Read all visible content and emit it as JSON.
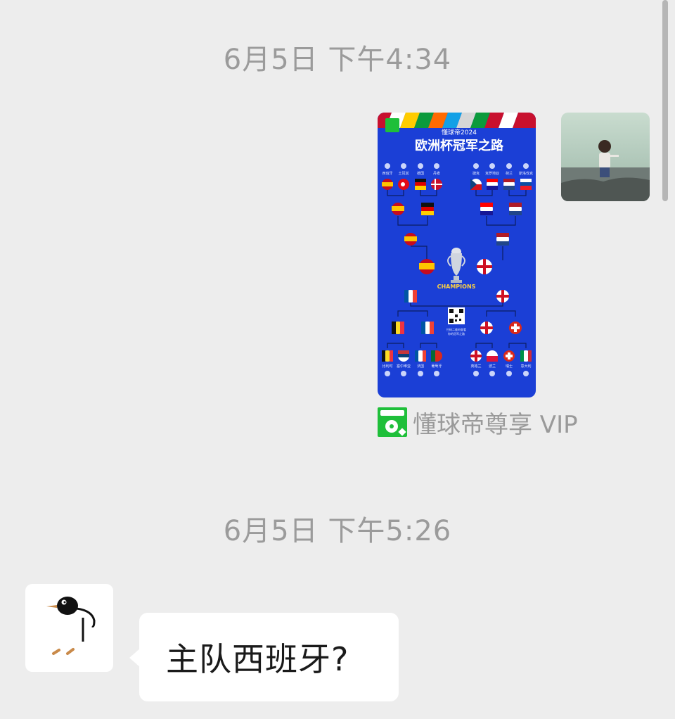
{
  "chat": {
    "timestamps": [
      "6月5日 下午4:34",
      "6月5日 下午5:26"
    ],
    "shared_card": {
      "brand_line": "懂球帝2024",
      "title": "欧洲杯冠军之路",
      "trophy_label": "CHAMPIONS",
      "qr_caption_line1": "扫码二维码查看",
      "qr_caption_line2": "你的冠军之路",
      "top_left_teams": [
        "西班牙",
        "土耳其",
        "德国",
        "丹麦"
      ],
      "top_right_teams": [
        "捷克",
        "克罗地亚",
        "荷兰",
        "斯洛伐克"
      ],
      "bottom_left_teams": [
        "比利时",
        "塞尔维亚",
        "法国",
        "葡萄牙"
      ],
      "bottom_right_teams": [
        "英格兰",
        "波兰",
        "瑞士",
        "意大利"
      ]
    },
    "source_label": "懂球帝尊享 VIP",
    "incoming_message": "主队西班牙?"
  },
  "colors": {
    "background": "#ededed",
    "card_blue": "#1b3fd6",
    "source_green": "#1fbf3a",
    "timestamp_gray": "#9b9b9b"
  },
  "icons": [
    "avatar-photo-icon",
    "penguin-avatar-icon",
    "dongqiudi-logo-icon",
    "trophy-icon",
    "qr-code-icon"
  ]
}
